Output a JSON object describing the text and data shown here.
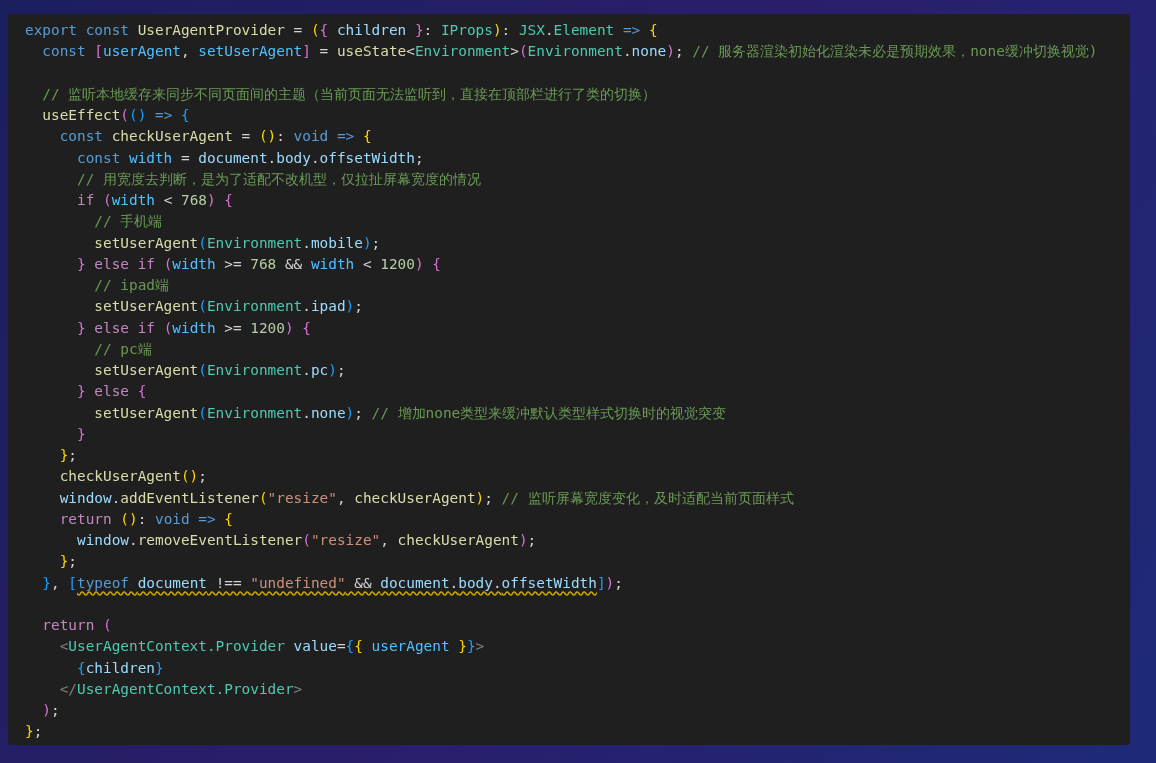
{
  "editor": {
    "lines": [
      {
        "kind": "code",
        "tokens": [
          {
            "kind": "keyword",
            "text": "export const "
          },
          {
            "kind": "function",
            "text": "UserAgentProvider"
          },
          {
            "kind": "plain",
            "text": " = "
          },
          {
            "kind": "bracket1",
            "text": "("
          },
          {
            "kind": "bracket2",
            "text": "{"
          },
          {
            "kind": "variable",
            "text": " children "
          },
          {
            "kind": "bracket2",
            "text": "}"
          },
          {
            "kind": "plain",
            "text": ": "
          },
          {
            "kind": "type",
            "text": "IProps"
          },
          {
            "kind": "bracket1",
            "text": ")"
          },
          {
            "kind": "plain",
            "text": ": "
          },
          {
            "kind": "type",
            "text": "JSX"
          },
          {
            "kind": "plain",
            "text": "."
          },
          {
            "kind": "type",
            "text": "Element"
          },
          {
            "kind": "keyword",
            "text": " => "
          },
          {
            "kind": "bracket1",
            "text": "{"
          }
        ]
      },
      {
        "kind": "code",
        "tokens": [
          {
            "kind": "keyword",
            "text": "  const "
          },
          {
            "kind": "bracket2",
            "text": "["
          },
          {
            "kind": "constant",
            "text": "userAgent"
          },
          {
            "kind": "plain",
            "text": ", "
          },
          {
            "kind": "constant",
            "text": "setUserAgent"
          },
          {
            "kind": "bracket2",
            "text": "]"
          },
          {
            "kind": "plain",
            "text": " = "
          },
          {
            "kind": "function",
            "text": "useState"
          },
          {
            "kind": "plain",
            "text": "<"
          },
          {
            "kind": "type",
            "text": "Environment"
          },
          {
            "kind": "plain",
            "text": ">"
          },
          {
            "kind": "bracket2",
            "text": "("
          },
          {
            "kind": "type",
            "text": "Environment"
          },
          {
            "kind": "plain",
            "text": "."
          },
          {
            "kind": "variable",
            "text": "none"
          },
          {
            "kind": "bracket2",
            "text": ")"
          },
          {
            "kind": "plain",
            "text": "; "
          },
          {
            "kind": "comment",
            "text": "// 服务器渲染初始化渲染未必是预期效果，none缓冲切换视觉)"
          }
        ]
      },
      {
        "kind": "blank"
      },
      {
        "kind": "code",
        "tokens": [
          {
            "kind": "comment",
            "text": "  // 监听本地缓存来同步不同页面间的主题（当前页面无法监听到，直接在顶部栏进行了类的切换）"
          }
        ]
      },
      {
        "kind": "code",
        "tokens": [
          {
            "kind": "function",
            "text": "  useEffect"
          },
          {
            "kind": "bracket2",
            "text": "("
          },
          {
            "kind": "bracket3",
            "text": "()"
          },
          {
            "kind": "keyword",
            "text": " => "
          },
          {
            "kind": "bracket3",
            "text": "{"
          }
        ]
      },
      {
        "kind": "code",
        "tokens": [
          {
            "kind": "keyword",
            "text": "    const "
          },
          {
            "kind": "function",
            "text": "checkUserAgent"
          },
          {
            "kind": "plain",
            "text": " = "
          },
          {
            "kind": "bracket1",
            "text": "()"
          },
          {
            "kind": "plain",
            "text": ": "
          },
          {
            "kind": "keyword",
            "text": "void => "
          },
          {
            "kind": "bracket1",
            "text": "{"
          }
        ]
      },
      {
        "kind": "code",
        "tokens": [
          {
            "kind": "keyword",
            "text": "      const "
          },
          {
            "kind": "constant",
            "text": "width"
          },
          {
            "kind": "plain",
            "text": " = "
          },
          {
            "kind": "variable",
            "text": "document"
          },
          {
            "kind": "plain",
            "text": "."
          },
          {
            "kind": "variable",
            "text": "body"
          },
          {
            "kind": "plain",
            "text": "."
          },
          {
            "kind": "variable",
            "text": "offsetWidth"
          },
          {
            "kind": "plain",
            "text": ";"
          }
        ]
      },
      {
        "kind": "code",
        "tokens": [
          {
            "kind": "comment",
            "text": "      // 用宽度去判断，是为了适配不改机型，仅拉扯屏幕宽度的情况"
          }
        ]
      },
      {
        "kind": "code",
        "tokens": [
          {
            "kind": "control",
            "text": "      if "
          },
          {
            "kind": "bracket2",
            "text": "("
          },
          {
            "kind": "constant",
            "text": "width"
          },
          {
            "kind": "plain",
            "text": " < "
          },
          {
            "kind": "number",
            "text": "768"
          },
          {
            "kind": "bracket2",
            "text": ") {"
          }
        ]
      },
      {
        "kind": "code",
        "tokens": [
          {
            "kind": "comment",
            "text": "        // 手机端"
          }
        ]
      },
      {
        "kind": "code",
        "tokens": [
          {
            "kind": "function",
            "text": "        setUserAgent"
          },
          {
            "kind": "bracket3",
            "text": "("
          },
          {
            "kind": "type",
            "text": "Environment"
          },
          {
            "kind": "plain",
            "text": "."
          },
          {
            "kind": "variable",
            "text": "mobile"
          },
          {
            "kind": "bracket3",
            "text": ")"
          },
          {
            "kind": "plain",
            "text": ";"
          }
        ]
      },
      {
        "kind": "code",
        "tokens": [
          {
            "kind": "bracket2",
            "text": "      }"
          },
          {
            "kind": "control",
            "text": " else if "
          },
          {
            "kind": "bracket2",
            "text": "("
          },
          {
            "kind": "constant",
            "text": "width"
          },
          {
            "kind": "plain",
            "text": " >= "
          },
          {
            "kind": "number",
            "text": "768"
          },
          {
            "kind": "plain",
            "text": " && "
          },
          {
            "kind": "constant",
            "text": "width"
          },
          {
            "kind": "plain",
            "text": " < "
          },
          {
            "kind": "number",
            "text": "1200"
          },
          {
            "kind": "bracket2",
            "text": ") {"
          }
        ]
      },
      {
        "kind": "code",
        "tokens": [
          {
            "kind": "comment",
            "text": "        // ipad端"
          }
        ]
      },
      {
        "kind": "code",
        "tokens": [
          {
            "kind": "function",
            "text": "        setUserAgent"
          },
          {
            "kind": "bracket3",
            "text": "("
          },
          {
            "kind": "type",
            "text": "Environment"
          },
          {
            "kind": "plain",
            "text": "."
          },
          {
            "kind": "variable",
            "text": "ipad"
          },
          {
            "kind": "bracket3",
            "text": ")"
          },
          {
            "kind": "plain",
            "text": ";"
          }
        ]
      },
      {
        "kind": "code",
        "tokens": [
          {
            "kind": "bracket2",
            "text": "      }"
          },
          {
            "kind": "control",
            "text": " else if "
          },
          {
            "kind": "bracket2",
            "text": "("
          },
          {
            "kind": "constant",
            "text": "width"
          },
          {
            "kind": "plain",
            "text": " >= "
          },
          {
            "kind": "number",
            "text": "1200"
          },
          {
            "kind": "bracket2",
            "text": ") {"
          }
        ]
      },
      {
        "kind": "code",
        "tokens": [
          {
            "kind": "comment",
            "text": "        // pc端"
          }
        ]
      },
      {
        "kind": "code",
        "tokens": [
          {
            "kind": "function",
            "text": "        setUserAgent"
          },
          {
            "kind": "bracket3",
            "text": "("
          },
          {
            "kind": "type",
            "text": "Environment"
          },
          {
            "kind": "plain",
            "text": "."
          },
          {
            "kind": "variable",
            "text": "pc"
          },
          {
            "kind": "bracket3",
            "text": ")"
          },
          {
            "kind": "plain",
            "text": ";"
          }
        ]
      },
      {
        "kind": "code",
        "tokens": [
          {
            "kind": "bracket2",
            "text": "      }"
          },
          {
            "kind": "control",
            "text": " else "
          },
          {
            "kind": "bracket2",
            "text": "{"
          }
        ]
      },
      {
        "kind": "code",
        "tokens": [
          {
            "kind": "function",
            "text": "        setUserAgent"
          },
          {
            "kind": "bracket3",
            "text": "("
          },
          {
            "kind": "type",
            "text": "Environment"
          },
          {
            "kind": "plain",
            "text": "."
          },
          {
            "kind": "variable",
            "text": "none"
          },
          {
            "kind": "bracket3",
            "text": ")"
          },
          {
            "kind": "plain",
            "text": "; "
          },
          {
            "kind": "comment",
            "text": "// 增加none类型来缓冲默认类型样式切换时的视觉突变"
          }
        ]
      },
      {
        "kind": "code",
        "tokens": [
          {
            "kind": "bracket2",
            "text": "      }"
          }
        ]
      },
      {
        "kind": "code",
        "tokens": [
          {
            "kind": "bracket1",
            "text": "    }"
          },
          {
            "kind": "plain",
            "text": ";"
          }
        ]
      },
      {
        "kind": "code",
        "tokens": [
          {
            "kind": "function",
            "text": "    checkUserAgent"
          },
          {
            "kind": "bracket1",
            "text": "()"
          },
          {
            "kind": "plain",
            "text": ";"
          }
        ]
      },
      {
        "kind": "code",
        "tokens": [
          {
            "kind": "variable",
            "text": "    window"
          },
          {
            "kind": "plain",
            "text": "."
          },
          {
            "kind": "function",
            "text": "addEventListener"
          },
          {
            "kind": "bracket1",
            "text": "("
          },
          {
            "kind": "string",
            "text": "\"resize\""
          },
          {
            "kind": "plain",
            "text": ", "
          },
          {
            "kind": "function",
            "text": "checkUserAgent"
          },
          {
            "kind": "bracket1",
            "text": ")"
          },
          {
            "kind": "plain",
            "text": "; "
          },
          {
            "kind": "comment",
            "text": "// 监听屏幕宽度变化，及时适配当前页面样式"
          }
        ]
      },
      {
        "kind": "code",
        "tokens": [
          {
            "kind": "control",
            "text": "    return "
          },
          {
            "kind": "bracket1",
            "text": "()"
          },
          {
            "kind": "plain",
            "text": ": "
          },
          {
            "kind": "keyword",
            "text": "void => "
          },
          {
            "kind": "bracket1",
            "text": "{"
          }
        ]
      },
      {
        "kind": "code",
        "tokens": [
          {
            "kind": "variable",
            "text": "      window"
          },
          {
            "kind": "plain",
            "text": "."
          },
          {
            "kind": "function",
            "text": "removeEventListener"
          },
          {
            "kind": "bracket2",
            "text": "("
          },
          {
            "kind": "string",
            "text": "\"resize\""
          },
          {
            "kind": "plain",
            "text": ", "
          },
          {
            "kind": "function",
            "text": "checkUserAgent"
          },
          {
            "kind": "bracket2",
            "text": ")"
          },
          {
            "kind": "plain",
            "text": ";"
          }
        ]
      },
      {
        "kind": "code",
        "tokens": [
          {
            "kind": "bracket1",
            "text": "    }"
          },
          {
            "kind": "plain",
            "text": ";"
          }
        ]
      },
      {
        "kind": "code",
        "tokens": [
          {
            "kind": "bracket3",
            "text": "  }"
          },
          {
            "kind": "plain",
            "text": ", "
          },
          {
            "kind": "bracket3",
            "text": "["
          },
          {
            "kind": "keyword",
            "text": "typeof ",
            "warning": true
          },
          {
            "kind": "variable",
            "text": "document",
            "warning": true
          },
          {
            "kind": "plain",
            "text": " !== ",
            "warning": true
          },
          {
            "kind": "string",
            "text": "\"undefined\"",
            "warning": true
          },
          {
            "kind": "plain",
            "text": " && ",
            "warning": true
          },
          {
            "kind": "variable",
            "text": "document",
            "warning": true
          },
          {
            "kind": "plain",
            "text": ".",
            "warning": true
          },
          {
            "kind": "variable",
            "text": "body",
            "warning": true
          },
          {
            "kind": "plain",
            "text": ".",
            "warning": true
          },
          {
            "kind": "variable",
            "text": "offsetWidth",
            "warning": true
          },
          {
            "kind": "bracket3",
            "text": "]"
          },
          {
            "kind": "bracket2",
            "text": ")"
          },
          {
            "kind": "plain",
            "text": ";"
          }
        ]
      },
      {
        "kind": "blank"
      },
      {
        "kind": "code",
        "tokens": [
          {
            "kind": "control",
            "text": "  return "
          },
          {
            "kind": "bracket2",
            "text": "("
          }
        ]
      },
      {
        "kind": "code",
        "tokens": [
          {
            "kind": "tag",
            "text": "    <"
          },
          {
            "kind": "type",
            "text": "UserAgentContext.Provider"
          },
          {
            "kind": "variable",
            "text": " value"
          },
          {
            "kind": "plain",
            "text": "="
          },
          {
            "kind": "bracket3",
            "text": "{"
          },
          {
            "kind": "bracket1",
            "text": "{"
          },
          {
            "kind": "constant",
            "text": " userAgent "
          },
          {
            "kind": "bracket1",
            "text": "}"
          },
          {
            "kind": "bracket3",
            "text": "}"
          },
          {
            "kind": "tag",
            "text": ">"
          }
        ]
      },
      {
        "kind": "code",
        "tokens": [
          {
            "kind": "bracket3",
            "text": "      {"
          },
          {
            "kind": "variable",
            "text": "children"
          },
          {
            "kind": "bracket3",
            "text": "}"
          }
        ]
      },
      {
        "kind": "code",
        "tokens": [
          {
            "kind": "tag",
            "text": "    </"
          },
          {
            "kind": "type",
            "text": "UserAgentContext.Provider"
          },
          {
            "kind": "tag",
            "text": ">"
          }
        ]
      },
      {
        "kind": "code",
        "tokens": [
          {
            "kind": "bracket2",
            "text": "  )"
          },
          {
            "kind": "plain",
            "text": ";"
          }
        ]
      },
      {
        "kind": "code",
        "tokens": [
          {
            "kind": "bracket1",
            "text": "}"
          },
          {
            "kind": "plain",
            "text": ";"
          }
        ]
      }
    ]
  }
}
